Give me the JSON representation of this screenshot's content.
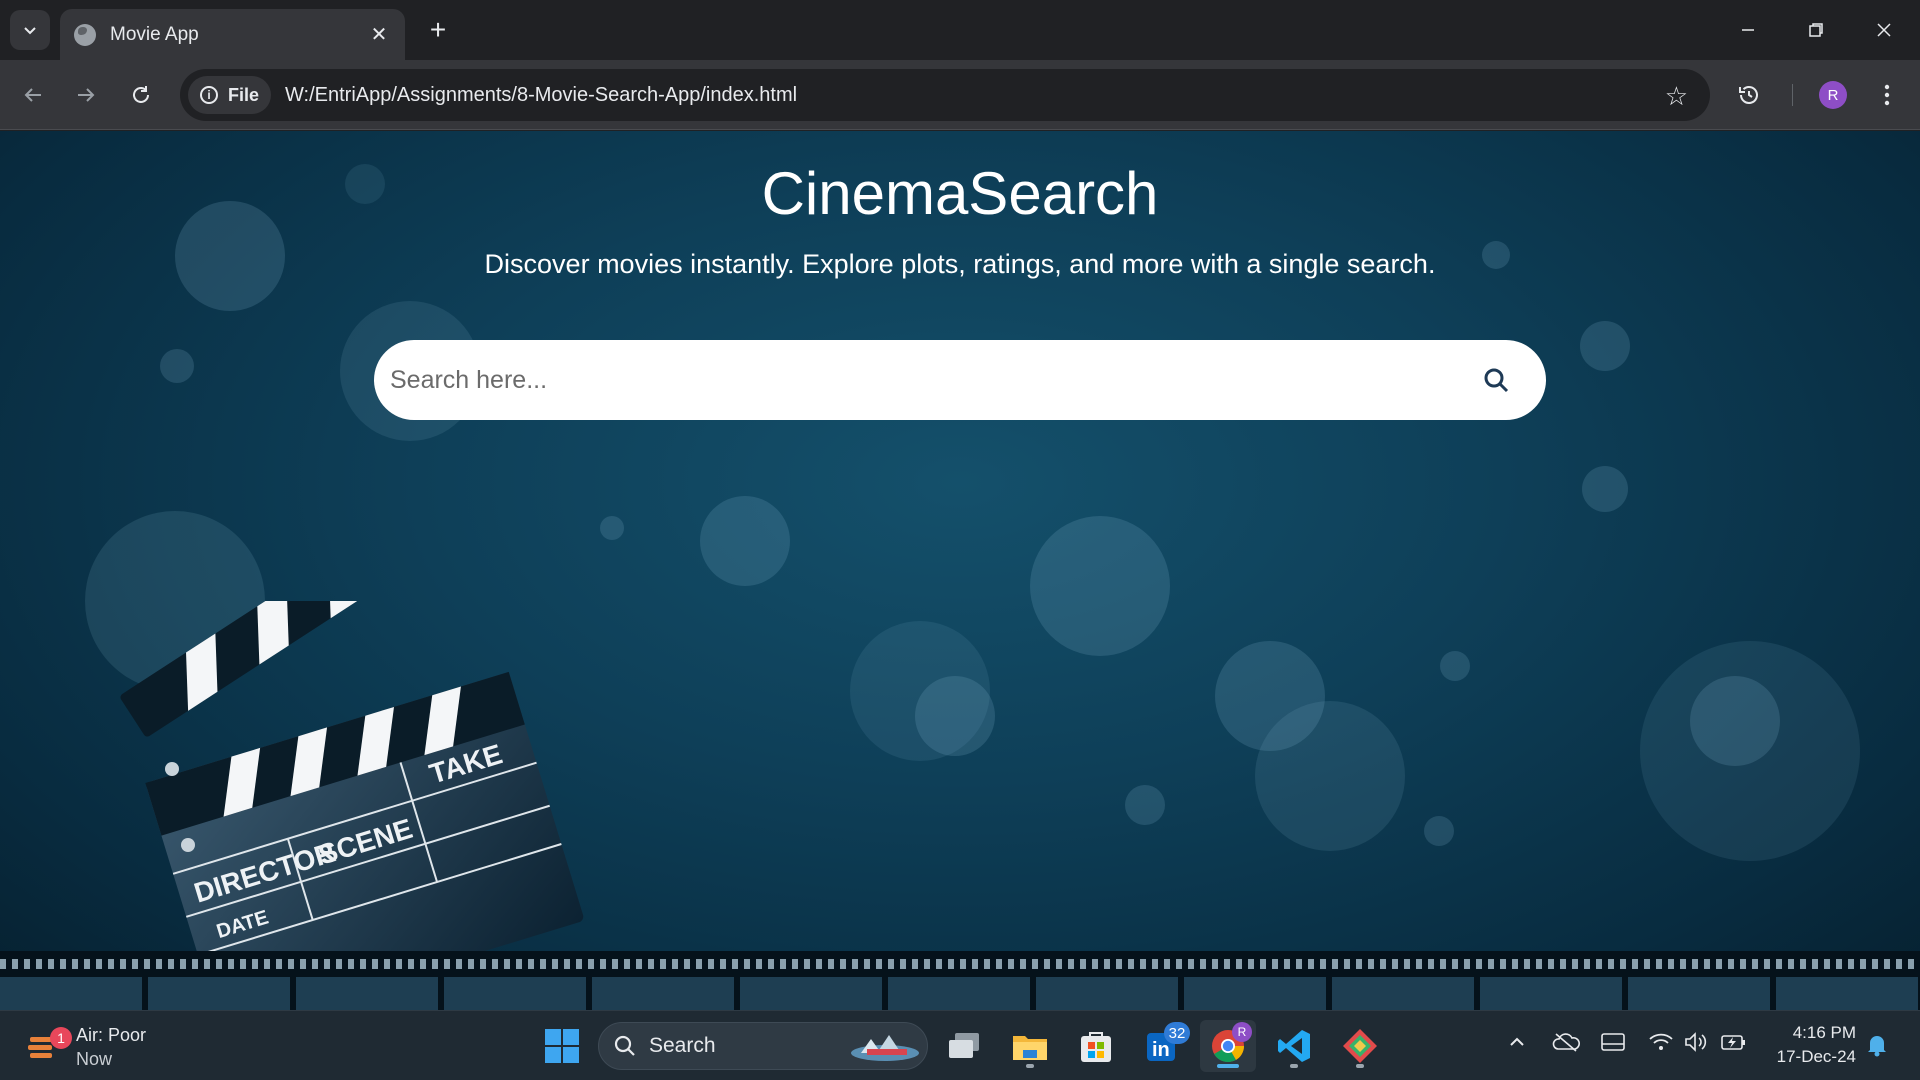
{
  "browser": {
    "tab_title": "Movie App",
    "chip_label": "File",
    "url": "W:/EntriApp/Assignments/8-Movie-Search-App/index.html",
    "profile_initial": "R"
  },
  "page": {
    "title": "CinemaSearch",
    "subtitle": "Discover movies instantly. Explore plots, ratings, and more with a single search.",
    "search_placeholder": "Search here...",
    "clapper": {
      "director": "DIRECTOR",
      "scene": "SCENE",
      "take": "TAKE",
      "date": "DATE"
    }
  },
  "taskbar": {
    "weather_title": "Air: Poor",
    "weather_sub": "Now",
    "weather_badge": "1",
    "search_label": "Search",
    "linkedin_badge": "32",
    "chrome_badge": "R",
    "time": "4:16 PM",
    "date": "17-Dec-24"
  },
  "colors": {
    "page_bg": "#0e3f58",
    "accent": "#8e4ec6"
  }
}
